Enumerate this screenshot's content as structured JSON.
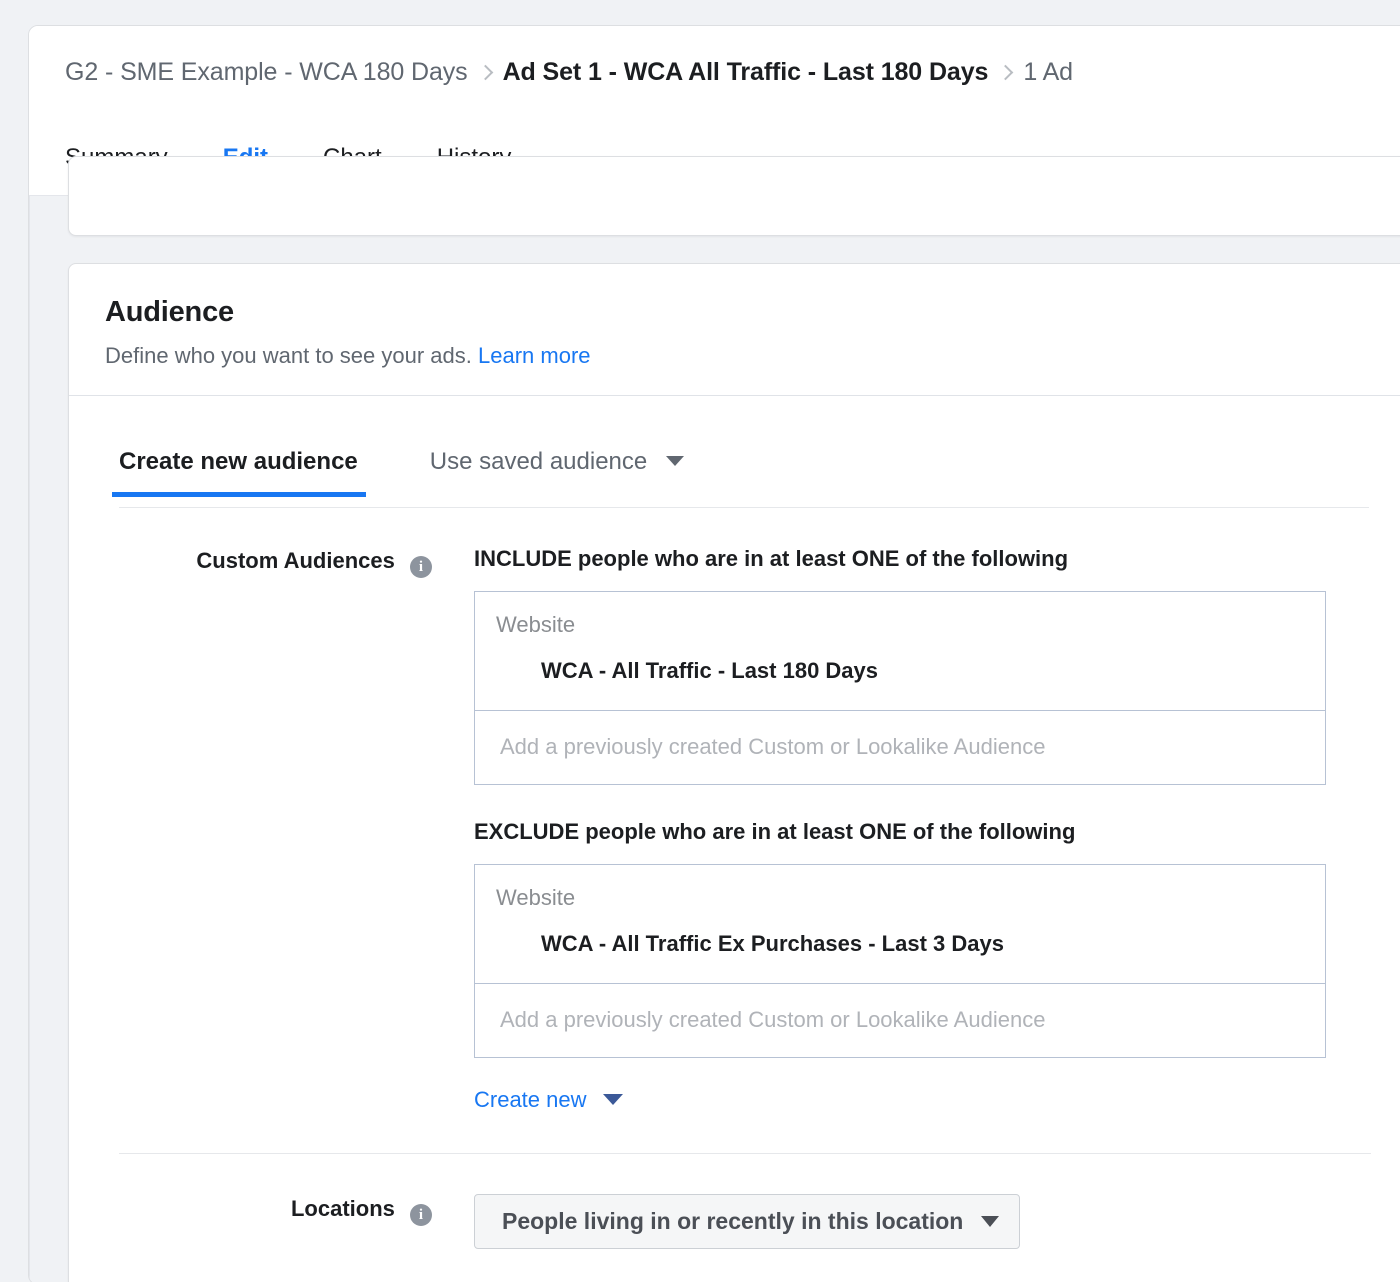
{
  "breadcrumb": {
    "items": [
      {
        "label": "G2 - SME Example - WCA 180 Days",
        "current": false
      },
      {
        "label": "Ad Set 1 - WCA All Traffic - Last 180 Days",
        "current": true
      },
      {
        "label": "1 Ad",
        "current": false
      }
    ]
  },
  "tabs": {
    "summary": "Summary",
    "edit": "Edit",
    "chart": "Chart",
    "history": "History",
    "active": "Edit"
  },
  "audience_card": {
    "title": "Audience",
    "subtitle": "Define who you want to see your ads.",
    "learn_more": "Learn more",
    "subtabs": {
      "create_new": "Create new audience",
      "use_saved": "Use saved audience"
    },
    "custom_audiences": {
      "label": "Custom Audiences",
      "include_title": "INCLUDE people who are in at least ONE of the following",
      "include_box": {
        "type": "Website",
        "name": "WCA - All Traffic - Last 180 Days"
      },
      "include_placeholder": "Add a previously created Custom or Lookalike Audience",
      "exclude_title": "EXCLUDE people who are in at least ONE of the following",
      "exclude_box": {
        "type": "Website",
        "name": "WCA - All Traffic Ex Purchases - Last 3 Days"
      },
      "exclude_placeholder": "Add a previously created Custom or Lookalike Audience",
      "create_new": "Create new"
    },
    "locations": {
      "label": "Locations",
      "selected": "People living in or recently in this location"
    }
  },
  "colors": {
    "accent_blue": "#1877f2",
    "link_blue": "#1877f2",
    "caret_navy": "#3b5998",
    "page_bg": "#f0f2f5",
    "text_primary": "#1c1e21",
    "text_secondary": "#606770",
    "field_border": "#b7c2d4"
  },
  "icons": {
    "info": "i",
    "chevron_right": "chevron-right-icon",
    "caret_down": "caret-down-icon"
  }
}
